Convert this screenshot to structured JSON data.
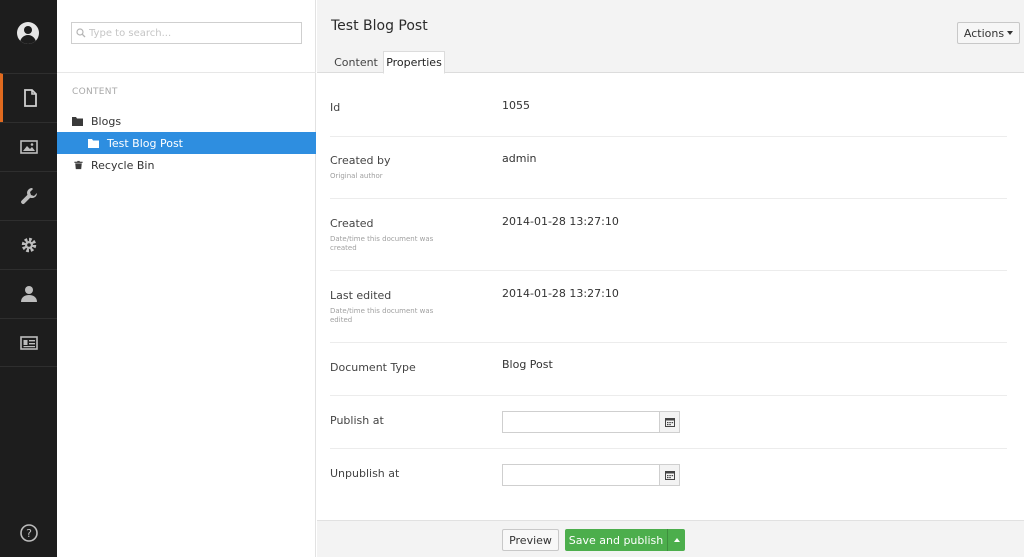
{
  "app": {
    "nav": [
      {
        "icon": "user-avatar-icon"
      },
      {
        "icon": "document-icon",
        "active": true
      },
      {
        "icon": "image-icon"
      },
      {
        "icon": "wrench-icon"
      },
      {
        "icon": "gear-icon"
      },
      {
        "icon": "person-icon"
      },
      {
        "icon": "id-card-icon"
      },
      {
        "icon": "help-icon"
      }
    ],
    "accent_color": "#e06a1f",
    "selection_color": "#2e8ee0",
    "publish_color": "#4cae4c"
  },
  "tree": {
    "search_placeholder": "Type to search...",
    "section_label": "CONTENT",
    "items": [
      {
        "label": "Blogs",
        "icon": "folder-icon"
      },
      {
        "label": "Test Blog Post",
        "icon": "folder-icon",
        "selected": true
      },
      {
        "label": "Recycle Bin",
        "icon": "trash-icon"
      }
    ]
  },
  "editor": {
    "title": "Test Blog Post",
    "actions_label": "Actions",
    "tabs": [
      {
        "label": "Content"
      },
      {
        "label": "Properties",
        "active": true
      }
    ],
    "properties": [
      {
        "label": "Id",
        "description": "",
        "value": "1055"
      },
      {
        "label": "Created by",
        "description": "Original author",
        "value": "admin"
      },
      {
        "label": "Created",
        "description": "Date/time this document was created",
        "value": "2014-01-28 13:27:10"
      },
      {
        "label": "Last edited",
        "description": "Date/time this document was edited",
        "value": "2014-01-28 13:27:10"
      },
      {
        "label": "Document Type",
        "description": "",
        "value": "Blog Post"
      },
      {
        "label": "Publish at",
        "description": "",
        "value": ""
      },
      {
        "label": "Unpublish at",
        "description": "",
        "value": ""
      }
    ]
  },
  "footer": {
    "preview_label": "Preview",
    "save_publish_label": "Save and publish"
  }
}
